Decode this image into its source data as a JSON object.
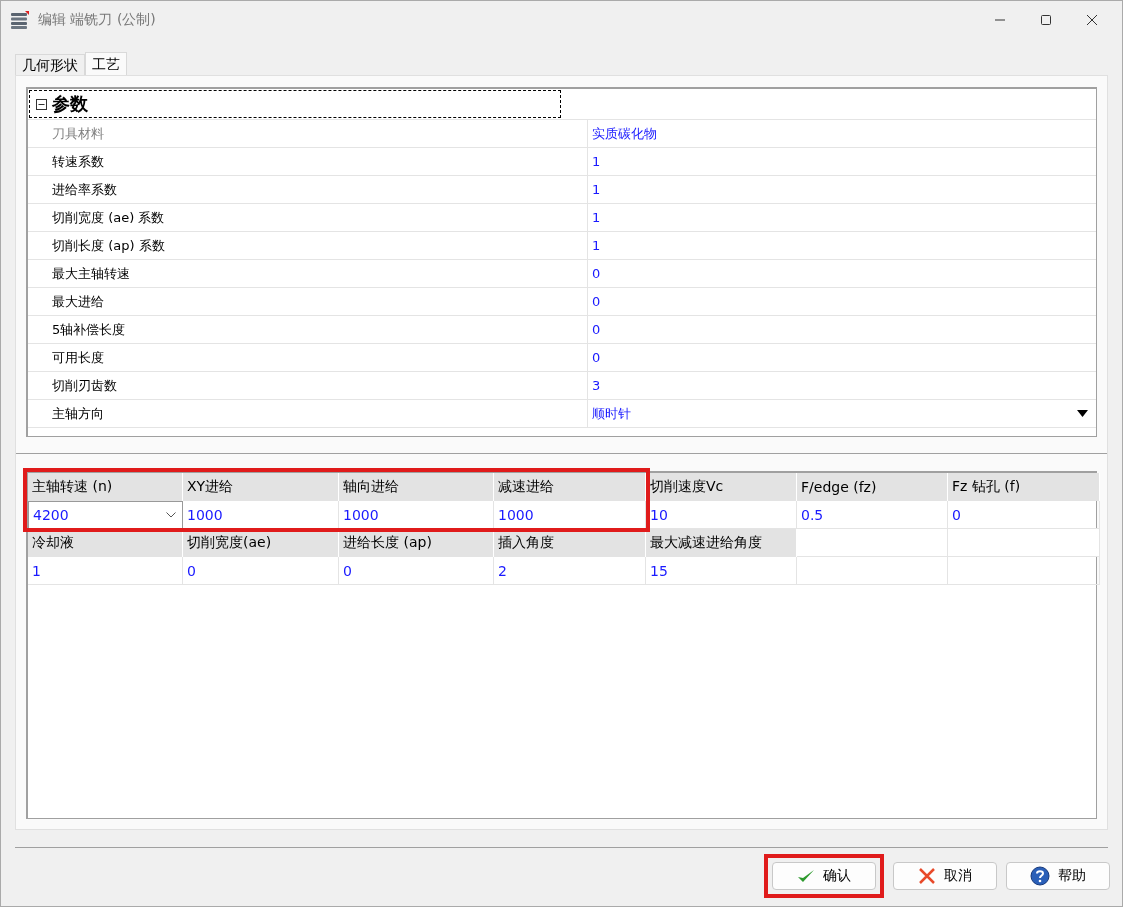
{
  "window": {
    "title": "编辑 端铣刀 (公制)"
  },
  "tabs": [
    {
      "label": "几何形状",
      "selected": false
    },
    {
      "label": "工艺",
      "selected": true
    }
  ],
  "property_grid": {
    "category": {
      "label": "参数",
      "expanded": true
    },
    "rows": [
      {
        "name": "刀具材料",
        "value": "实质碳化物",
        "disabled": true,
        "kind": "text"
      },
      {
        "name": "转速系数",
        "value": "1",
        "disabled": false,
        "kind": "text"
      },
      {
        "name": "进给率系数",
        "value": "1",
        "disabled": false,
        "kind": "text"
      },
      {
        "name": "切削宽度 (ae) 系数",
        "value": "1",
        "disabled": false,
        "kind": "text"
      },
      {
        "name": "切削长度 (ap) 系数",
        "value": "1",
        "disabled": false,
        "kind": "text"
      },
      {
        "name": "最大主轴转速",
        "value": "0",
        "disabled": false,
        "kind": "text"
      },
      {
        "name": "最大进给",
        "value": "0",
        "disabled": false,
        "kind": "text"
      },
      {
        "name": "5轴补偿长度",
        "value": "0",
        "disabled": false,
        "kind": "text"
      },
      {
        "name": "可用长度",
        "value": "0",
        "disabled": false,
        "kind": "text"
      },
      {
        "name": "切削刃齿数",
        "value": "3",
        "disabled": false,
        "kind": "text"
      },
      {
        "name": "主轴方向",
        "value": "顺时针",
        "disabled": false,
        "kind": "dropdown"
      }
    ]
  },
  "parameter_grid": {
    "row_groups": [
      {
        "cells": [
          {
            "kind": "dropdown",
            "label": "主轴转速 (n)",
            "value": "4200",
            "highlighted": true
          },
          {
            "kind": "text",
            "label": "XY进给",
            "value": "1000",
            "highlighted": true
          },
          {
            "kind": "text",
            "label": "轴向进给",
            "value": "1000",
            "highlighted": true
          },
          {
            "kind": "text",
            "label": "减速进给",
            "value": "1000",
            "highlighted": true
          },
          {
            "kind": "text",
            "label": "切削速度Vc",
            "value": "10",
            "highlighted": false
          },
          {
            "kind": "text",
            "label": "F/edge (fz)",
            "value": "0.5",
            "highlighted": false
          },
          {
            "kind": "text",
            "label": "Fz 钻孔 (f)",
            "value": "0",
            "highlighted": false
          }
        ]
      },
      {
        "cells": [
          {
            "kind": "text",
            "label": "冷却液",
            "value": "1"
          },
          {
            "kind": "text",
            "label": "切削宽度(ae)",
            "value": "0"
          },
          {
            "kind": "text",
            "label": "进给长度 (ap)",
            "value": "0"
          },
          {
            "kind": "text",
            "label": "插入角度",
            "value": "2"
          },
          {
            "kind": "text",
            "label": "最大减速进给角度",
            "value": "15"
          },
          {
            "kind": "empty"
          },
          {
            "kind": "empty"
          }
        ]
      }
    ]
  },
  "buttons": [
    {
      "kind": "ok",
      "label": "确认",
      "highlighted": true
    },
    {
      "kind": "cancel",
      "label": "取消",
      "highlighted": false
    },
    {
      "kind": "help",
      "label": "帮助",
      "highlighted": false
    }
  ]
}
